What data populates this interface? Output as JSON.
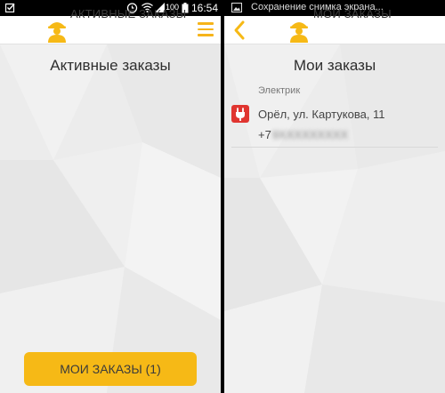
{
  "left_screen": {
    "status_bar": {
      "time": "16:54",
      "battery_percent": "100",
      "icons": [
        "checkbox-notification-icon",
        "alarm-icon",
        "wifi-icon",
        "signal-icon",
        "battery-icon"
      ]
    },
    "app_bar": {
      "title": "АКТИВНЫЕ ЗАКАЗЫ",
      "logo_icon": "worker-logo-icon",
      "menu_icon": "hamburger-menu-icon"
    },
    "heading": "Активные заказы",
    "bottom_button_label": "МОИ ЗАКАЗЫ (1)"
  },
  "right_screen": {
    "status_bar": {
      "notification_text": "Сохранение снимка экрана...",
      "icons": [
        "image-notification-icon"
      ]
    },
    "app_bar": {
      "title": "МОИ ЗАКАЗЫ",
      "logo_icon": "worker-logo-icon",
      "back_icon": "chevron-left-icon"
    },
    "heading": "Мои заказы",
    "orders": [
      {
        "category": "Электрик",
        "icon": "electric-plug-icon",
        "address": "Орёл, ул. Картукова, 11",
        "phone_prefix": "+7",
        "phone_hidden": "9XXXXXXXXX"
      }
    ]
  },
  "colors": {
    "accent": "#f6b916",
    "order_icon": "#e03530",
    "background": "#ececec"
  }
}
